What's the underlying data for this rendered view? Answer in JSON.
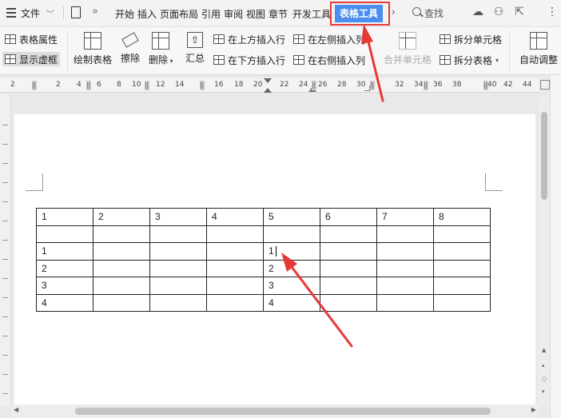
{
  "menubar": {
    "file": "文件",
    "tabs": [
      "开始",
      "插入",
      "页面布局",
      "引用",
      "审阅",
      "视图",
      "章节",
      "开发工具"
    ],
    "active_tab": "表格工具",
    "search": "查找",
    "highlight_color": "#e53935",
    "accent_color": "#4a8ef0"
  },
  "ribbon": {
    "table_props": "表格属性",
    "show_gridlines": "显示虚框",
    "draw_table": "绘制表格",
    "erase": "擦除",
    "delete": "删除",
    "summary": "汇总",
    "insert_above": "在上方插入行",
    "insert_below": "在下方插入行",
    "insert_left": "在左侧插入列",
    "insert_right": "在右侧插入列",
    "merge_cells": "合并单元格",
    "split_cells": "拆分单元格",
    "split_table": "拆分表格",
    "auto_fit": "自动调整"
  },
  "ruler": {
    "numbers": [
      "2",
      "2",
      "4",
      "6",
      "8",
      "10",
      "12",
      "14",
      "16",
      "18",
      "20",
      "22",
      "24",
      "26",
      "28",
      "30",
      "32",
      "34",
      "36",
      "38",
      "40",
      "42",
      "44"
    ]
  },
  "table": {
    "rows": [
      [
        "1",
        "2",
        "3",
        "4",
        "5",
        "6",
        "7",
        "8"
      ],
      [
        "",
        "",
        "",
        "",
        "",
        "",
        "",
        ""
      ],
      [
        "1",
        "",
        "",
        "",
        "1",
        "",
        "",
        ""
      ],
      [
        "2",
        "",
        "",
        "",
        "2",
        "",
        "",
        ""
      ],
      [
        "3",
        "",
        "",
        "",
        "3",
        "",
        "",
        ""
      ],
      [
        "4",
        "",
        "",
        "",
        "4",
        "",
        "",
        ""
      ]
    ]
  }
}
